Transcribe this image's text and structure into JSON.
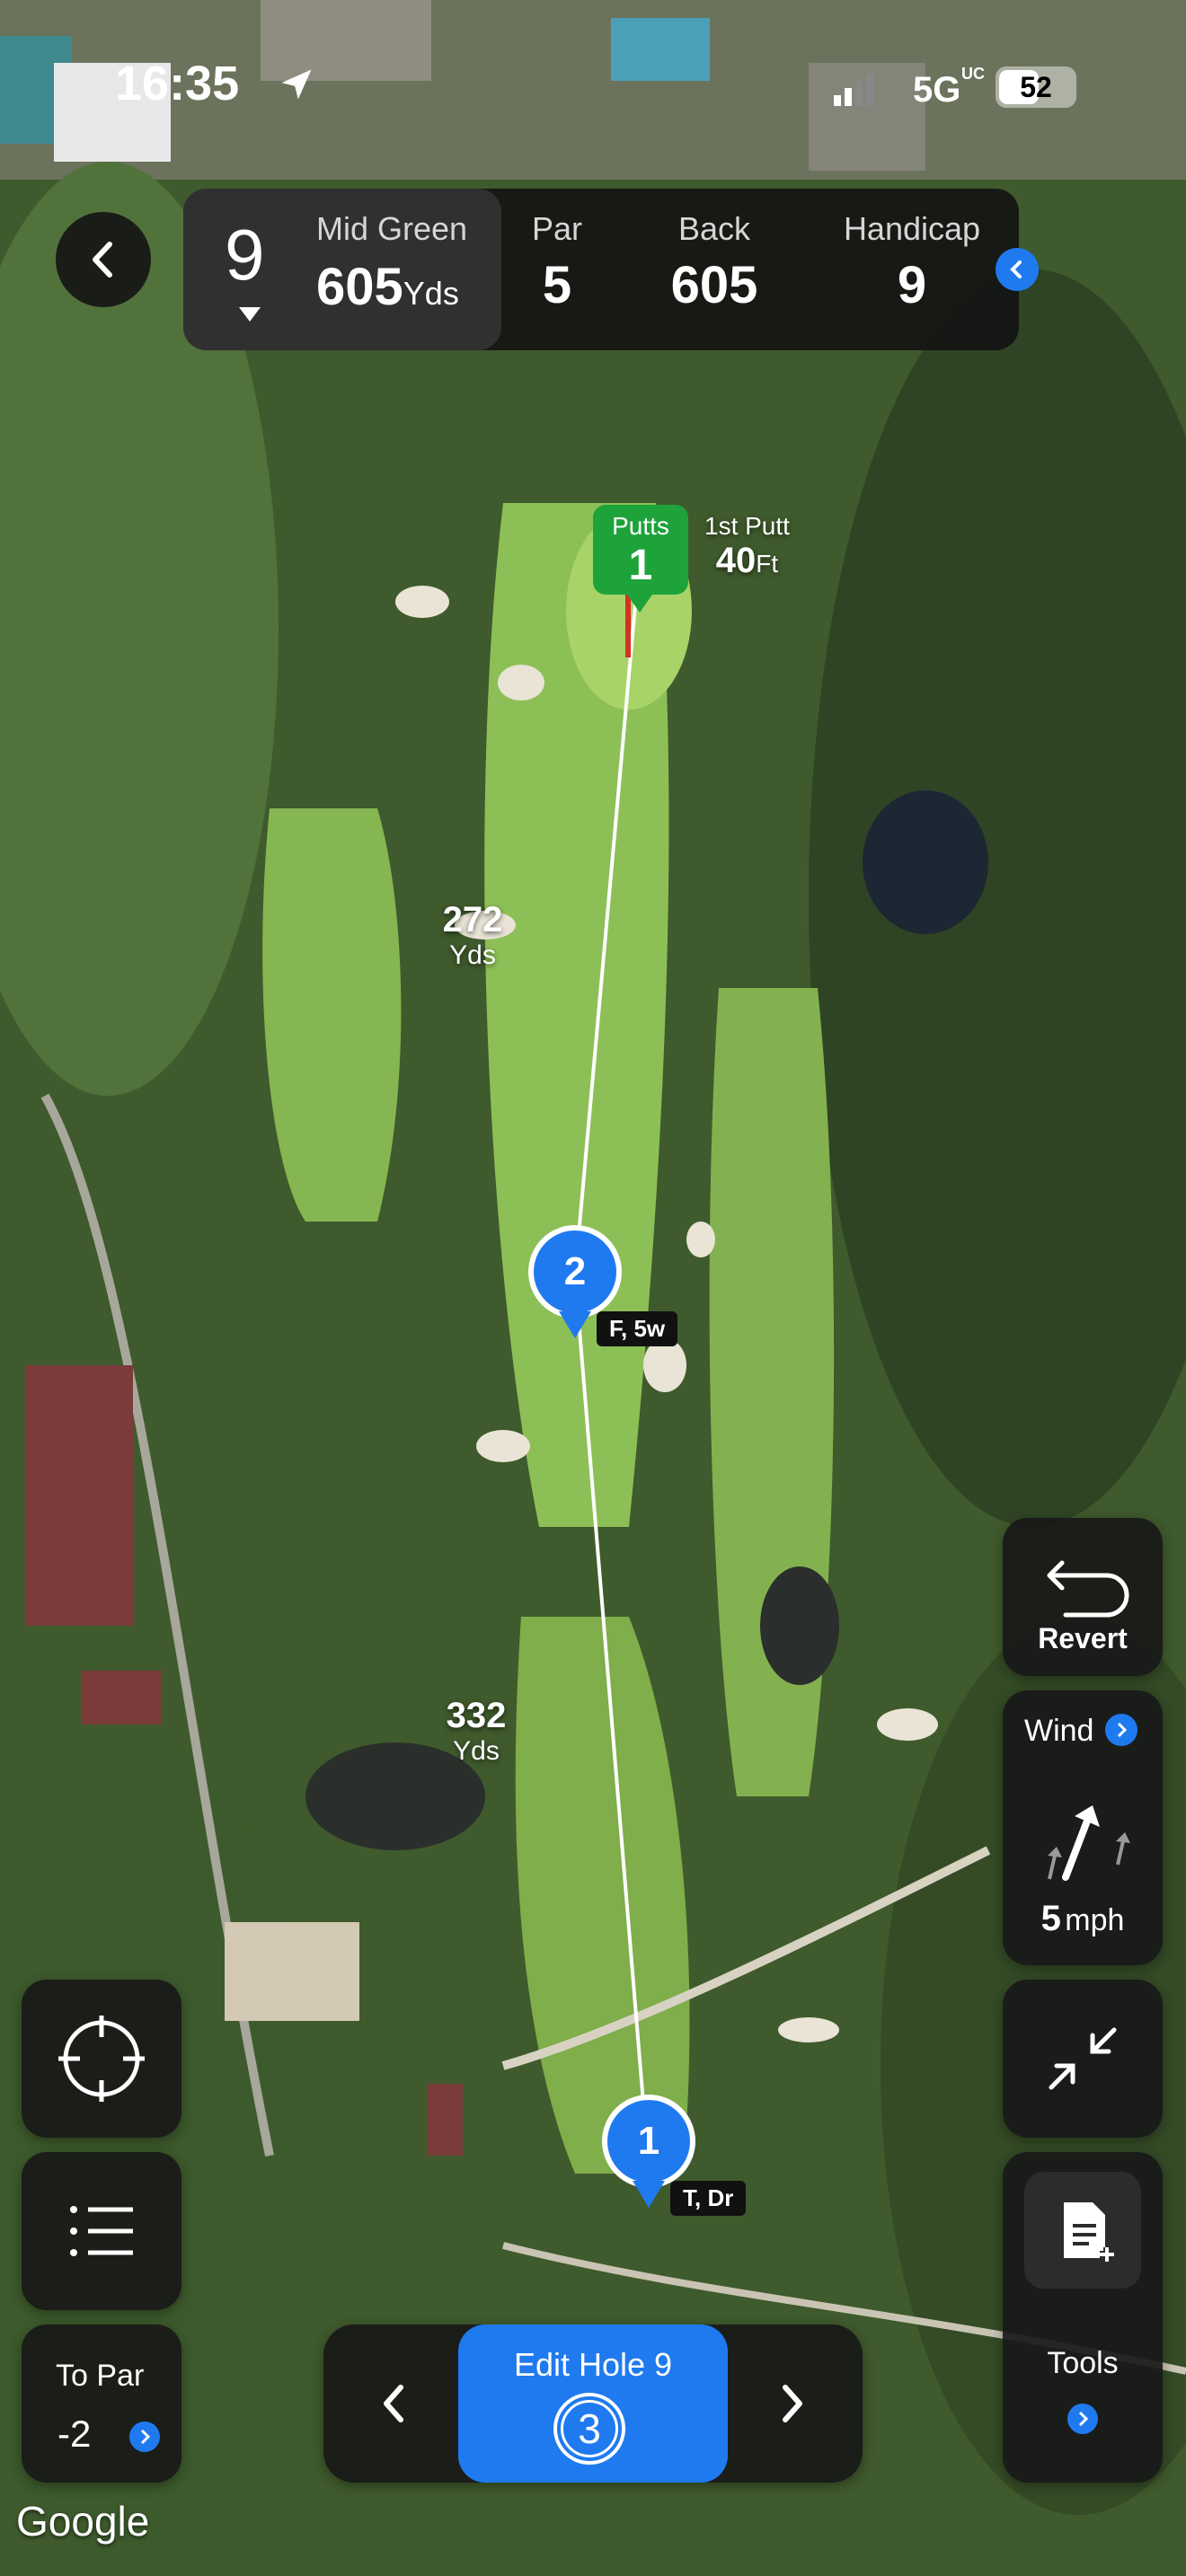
{
  "status_bar": {
    "time": "16:35",
    "network": "5G",
    "network_sup": "UC",
    "battery": "52"
  },
  "hole_info": {
    "hole_number": "9",
    "distance_label": "Mid Green",
    "distance_value": "605",
    "distance_unit": "Yds",
    "par_label": "Par",
    "par_value": "5",
    "tee_label": "Back",
    "tee_value": "605",
    "handicap_label": "Handicap",
    "handicap_value": "9"
  },
  "map": {
    "green_flag": {
      "label": "Putts",
      "value": "1"
    },
    "first_putt": {
      "label": "1st Putt",
      "value": "40",
      "unit": "Ft"
    },
    "yardage_markers": [
      {
        "value": "272",
        "unit": "Yds"
      },
      {
        "value": "332",
        "unit": "Yds"
      }
    ],
    "shots": [
      {
        "number": "1",
        "club": "T, Dr"
      },
      {
        "number": "2",
        "club": "F, 5w"
      }
    ],
    "attribution": "Google"
  },
  "right_panel": {
    "revert_label": "Revert",
    "wind_label": "Wind",
    "wind_speed": "5",
    "wind_unit": "mph",
    "tools_label": "Tools"
  },
  "bottom": {
    "edit_hole_label": "Edit Hole 9",
    "strokes": "3",
    "to_par_label": "To Par",
    "to_par_value": "-2"
  },
  "colors": {
    "accent": "#1f7af0",
    "flag_green": "#1ea33b",
    "panel": "#181818"
  }
}
